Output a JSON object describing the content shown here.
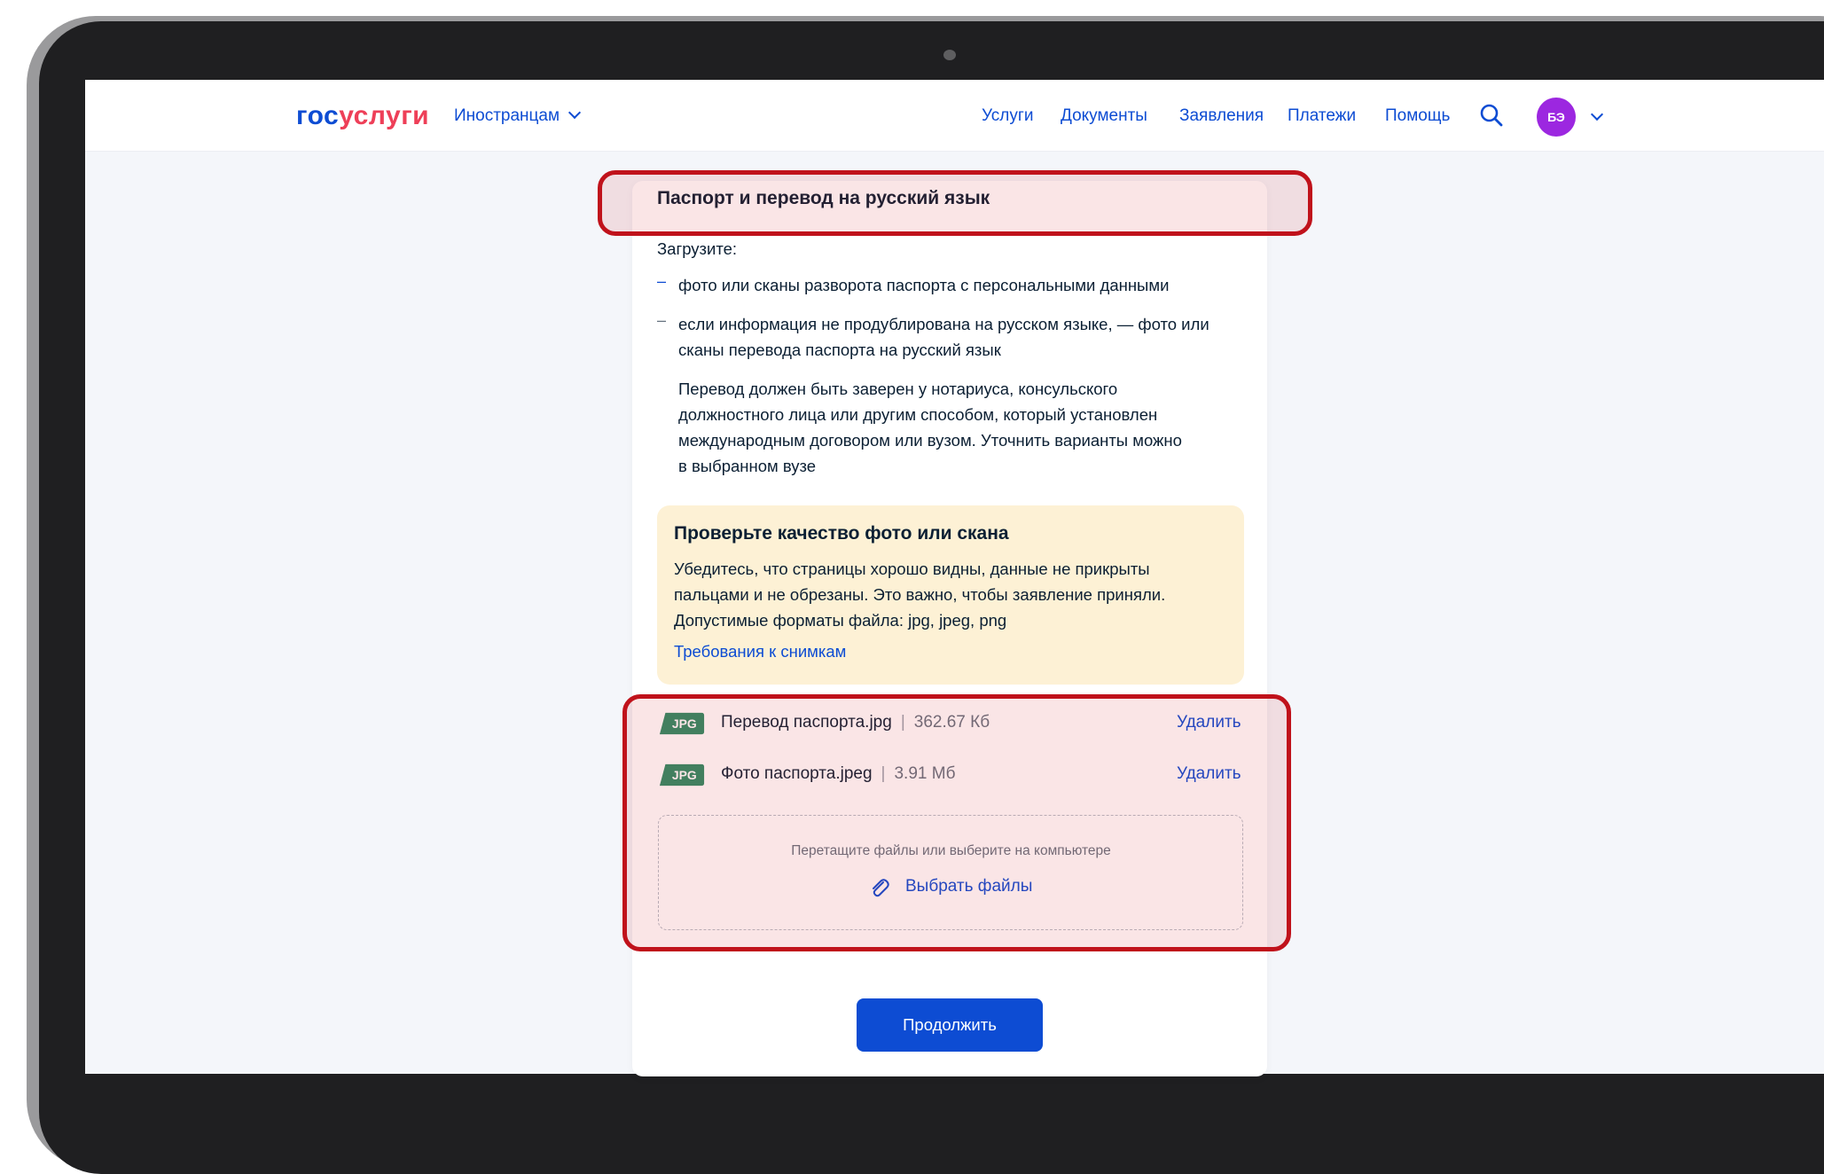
{
  "header": {
    "logo_part1": "гос",
    "logo_part2": "услуги",
    "audience_menu": "Иностранцам",
    "nav": [
      "Услуги",
      "Документы",
      "Заявления",
      "Платежи",
      "Помощь"
    ],
    "avatar_initials": "БЭ",
    "icons": [
      "search-icon",
      "chevron-down-icon"
    ]
  },
  "section": {
    "title": "Паспорт и перевод на русский язык",
    "upload_intro": "Загрузите:",
    "bullet1": "фото или сканы разворота паспорта с персональными данными",
    "bullet2_line1": "если информация не продублирована на русском языке, — фото или",
    "bullet2_line2": "сканы перевода паспорта на русский язык",
    "note_line1": "Перевод должен быть заверен у нотариуса, консульского",
    "note_line2": "должностного лица или другим способом, который установлен",
    "note_line3": "международным договором или вузом. Уточнить варианты можно",
    "note_line4": "в выбранном вузе",
    "bullet_marker": "–"
  },
  "warning": {
    "title": "Проверьте качество фото или скана",
    "line1": "Убедитесь, что страницы хорошо видны, данные не прикрыты",
    "line2": "пальцами и не обрезаны. Это важно, чтобы заявление приняли.",
    "line3": "Допустимые форматы файла: jpg, jpeg, png",
    "link": "Требования к снимкам"
  },
  "files": [
    {
      "type": "JPG",
      "name": "Перевод паспорта.jpg",
      "separator": "|",
      "size": "362.67 Кб",
      "delete": "Удалить"
    },
    {
      "type": "JPG",
      "name": "Фото паспорта.jpeg",
      "separator": "|",
      "size": "3.91 Мб",
      "delete": "Удалить"
    }
  ],
  "dropzone": {
    "hint": "Перетащите файлы или выберите на компьютере",
    "button": "Выбрать файлы"
  },
  "continue_label": "Продолжить",
  "colors": {
    "primary": "#0d4cd3",
    "logo_accent": "#ee3f58",
    "avatar": "#9c27e0",
    "file_badge": "#2e8b66",
    "warning_bg": "#fdf1d5",
    "highlight": "#c0121b"
  }
}
